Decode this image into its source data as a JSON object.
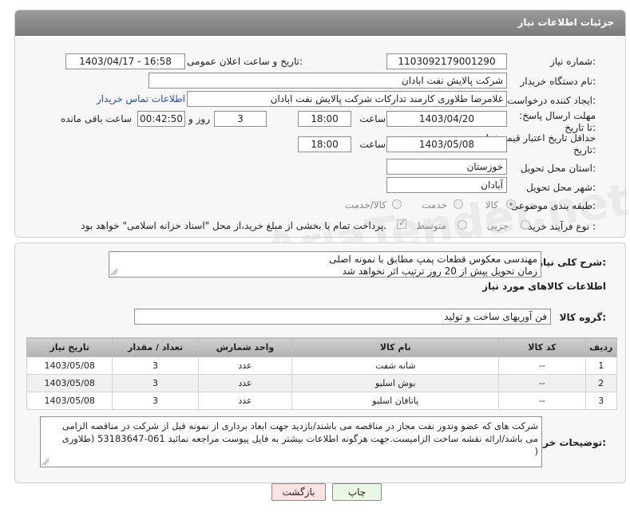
{
  "panel": {
    "title": "جزئیات اطلاعات نیاز"
  },
  "fields": {
    "need_number_label": "شماره نیاز:",
    "need_number": "1103092179001290",
    "announce_label": "تاریخ و ساعت اعلان عمومی:",
    "announce_value": "1403/04/17 - 16:58",
    "buyer_org_label": "نام دستگاه خریدار:",
    "buyer_org": "شرکت پالایش نفت ابادان",
    "requester_label": "ایجاد کننده درخواست:",
    "requester": "غلامرضا طلاوری کارمند تدارکات شرکت پالایش نفت ابادان",
    "buyer_contact_link": "اطلاعات تماس خریدار",
    "reply_deadline_label": "مهلت ارسال پاسخ: تا تاریخ:",
    "reply_date": "1403/04/20",
    "time_label": "ساعت",
    "reply_time": "18:00",
    "days_value": "3",
    "days_label": "روز و",
    "remaining_time": "00:42:50",
    "remaining_label": "ساعت باقی مانده",
    "price_validity_label": "حداقل تاریخ اعتبار قیمت: تا تاریخ:",
    "price_date": "1403/05/08",
    "price_time": "18:00",
    "province_label": "استان محل تحویل:",
    "province": "خوزستان",
    "city_label": "شهر محل تحویل:",
    "city": "آبادان",
    "category_label": "طبقه بندی موضوعی:",
    "category_options": [
      "کالا",
      "خدمت",
      "کالا/خدمت"
    ],
    "purchase_type_label": "نوع فرآیند خرید :",
    "purchase_options": [
      "جزیی",
      "متوسط"
    ],
    "payment_note": "پرداخت تمام یا بخشی از مبلغ خرید،از محل \"اسناد خزانه اسلامی\" خواهد بود."
  },
  "description": {
    "label": "شرح کلی نیاز:",
    "line1": "مهندسی معکوس قطعات پمپ مطابق با نمونه اصلی",
    "line2": "زمان تحویل بیش از 20 روز ترتیب اثر نخواهد شد"
  },
  "goods": {
    "section_title": "اطلاعات کالاهای مورد نیاز",
    "group_label": "گروه کالا:",
    "group_value": "فن آوریهای ساخت و تولید",
    "columns": [
      "ردیف",
      "کد کالا",
      "نام کالا",
      "واحد شمارش",
      "تعداد / مقدار",
      "تاریخ نیاز"
    ],
    "rows": [
      {
        "idx": "1",
        "code": "--",
        "name": "شانه شفت",
        "unit": "عدد",
        "qty": "3",
        "date": "1403/05/08"
      },
      {
        "idx": "2",
        "code": "--",
        "name": "بوش اسلیو",
        "unit": "عدد",
        "qty": "3",
        "date": "1403/05/08"
      },
      {
        "idx": "3",
        "code": "--",
        "name": "پاتافان اسلیو",
        "unit": "عدد",
        "qty": "3",
        "date": "1403/05/08"
      }
    ]
  },
  "buyer_notes": {
    "label": "توضیحات خریدار:",
    "line1": "شرکت های که عضو وندور نفت  مجاز در مناقصه می باشند/بازدید جهت ابعاد برداری از نمونه قبل از شرکت در مناقصه الزامی",
    "line2": "می باشد/ارائه نقشه ساخت الزامیست.جهت هرگونه اطلاعات بیشتر به فایل پیوست مراجعه نمائید  061-53183647 (طلاوری",
    "line3": ")"
  },
  "buttons": {
    "print": "چاپ",
    "back": "بازگشت"
  },
  "colors": {
    "header": "#8a8a8a",
    "link": "#1a55b8",
    "print_btn": "#eaf7e4",
    "back_btn": "#fbe3e3"
  }
}
